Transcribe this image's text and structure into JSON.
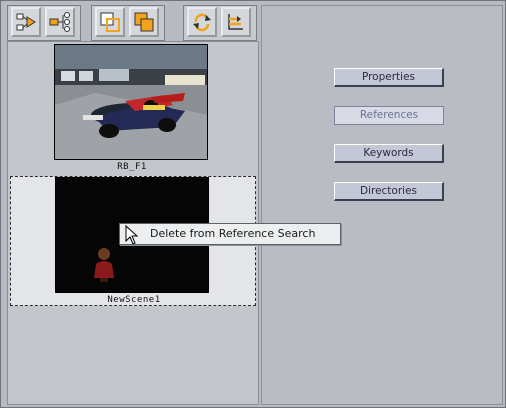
{
  "toolbar": {
    "buttons": [
      {
        "icon": "flowchart-icon"
      },
      {
        "icon": "tree-branch-icon"
      },
      {
        "icon": "layers-outline-icon"
      },
      {
        "icon": "layers-filled-icon"
      },
      {
        "icon": "rotate-refresh-icon"
      },
      {
        "icon": "hierarchy-arrows-icon"
      }
    ],
    "accent": "#f2a21b"
  },
  "thumbnails": [
    {
      "label": "RB_F1"
    },
    {
      "label": "NewScene1"
    }
  ],
  "context_menu": {
    "item": "Delete from Reference Search"
  },
  "right_buttons": [
    {
      "label": "Properties",
      "enabled": true
    },
    {
      "label": "References",
      "enabled": false
    },
    {
      "label": "Keywords",
      "enabled": true
    },
    {
      "label": "Directories",
      "enabled": true
    }
  ]
}
